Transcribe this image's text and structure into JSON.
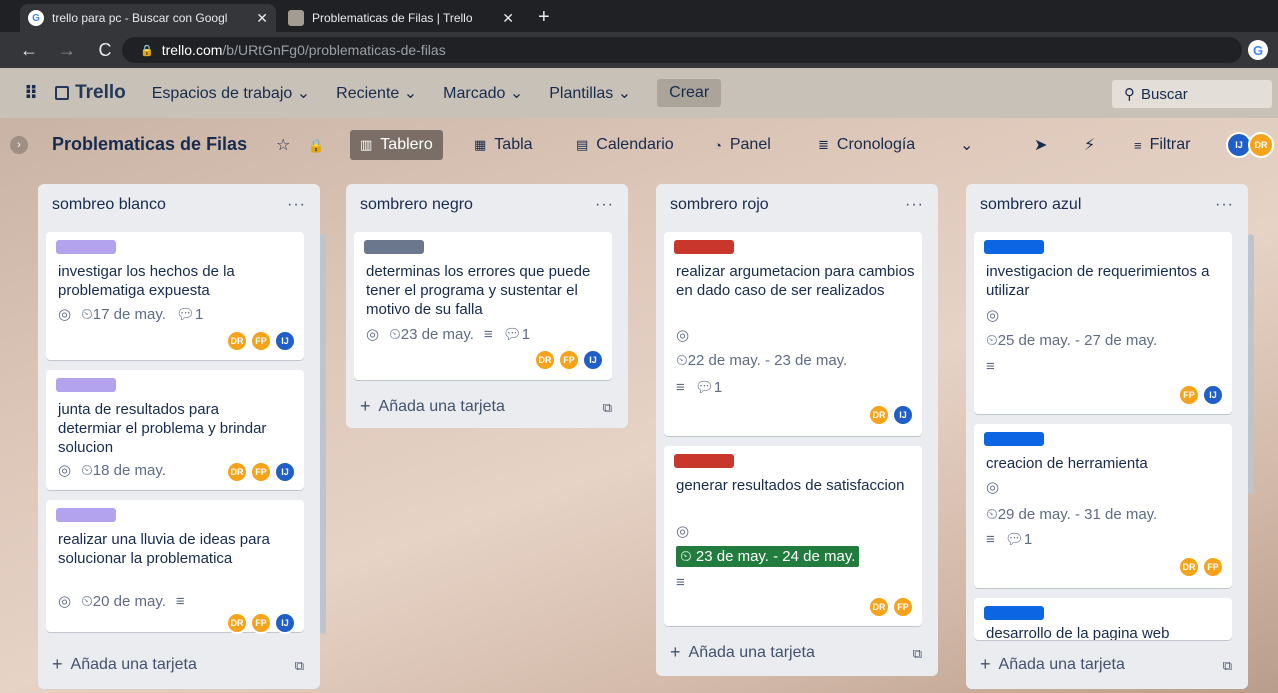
{
  "browser": {
    "tabs": [
      {
        "title": "trello para pc - Buscar con Googl",
        "close": "✕"
      },
      {
        "title": "Problematicas de Filas | Trello",
        "close": "✕"
      }
    ],
    "new_tab": "+",
    "url_domain": "trello.com",
    "url_path": "/b/URtGnFg0/problematicas-de-filas"
  },
  "header": {
    "logo": "Trello",
    "menu": [
      "Espacios de trabajo ⌄",
      "Reciente ⌄",
      "Marcado ⌄",
      "Plantillas ⌄"
    ],
    "create": "Crear",
    "search_placeholder": "Buscar"
  },
  "board": {
    "title": "Problematicas de Filas",
    "views": [
      "Tablero",
      "Tabla",
      "Calendario",
      "Panel",
      "Cronología"
    ],
    "filter": "Filtrar",
    "members": [
      "IJ",
      "DR"
    ]
  },
  "lists": [
    {
      "name": "sombreo blanco",
      "add": "Añada una tarjeta",
      "cards": [
        {
          "text": "investigar los hechos de la problematiga expuesta",
          "date": "17 de may.",
          "comments": "1",
          "members": [
            "DR",
            "FP",
            "IJ"
          ]
        },
        {
          "text": "junta de resultados para determiar el problema y brindar solucion",
          "date": "18 de may.",
          "members": [
            "DR",
            "FP",
            "IJ"
          ]
        },
        {
          "text": "realizar una lluvia de ideas para solucionar la problematica",
          "date": "20 de may.",
          "members": [
            "DR",
            "FP",
            "IJ"
          ]
        }
      ]
    },
    {
      "name": "sombrero negro",
      "add": "Añada una tarjeta",
      "cards": [
        {
          "text": "determinas los errores que puede tener el programa y sustentar el motivo de su falla",
          "date": "23 de may.",
          "comments": "1",
          "members": [
            "DR",
            "FP",
            "IJ"
          ]
        }
      ]
    },
    {
      "name": "sombrero rojo",
      "add": "Añada una tarjeta",
      "cards": [
        {
          "text": "realizar argumetacion para cambios en dado caso de ser realizados",
          "date": "22 de may. - 23 de may.",
          "comments": "1",
          "members": [
            "DR",
            "IJ"
          ]
        },
        {
          "text": "generar resultados de satisfaccion",
          "date": "23 de may. - 24 de may.",
          "members": [
            "DR",
            "FP"
          ]
        }
      ]
    },
    {
      "name": "sombrero azul",
      "add": "Añada una tarjeta",
      "cards": [
        {
          "text": "investigacion de requerimientos a utilizar",
          "date": "25 de may. - 27 de may.",
          "members": [
            "FP",
            "IJ"
          ]
        },
        {
          "text": "creacion de herramienta",
          "date": "29 de may. - 31 de may.",
          "comments": "1",
          "members": [
            "DR",
            "FP"
          ]
        },
        {
          "text": "desarrollo de la pagina web"
        }
      ]
    }
  ],
  "icons": {
    "watch": "◎",
    "clock": "🕓",
    "desc": "≡",
    "comment": "▭",
    "star": "☆",
    "lock": "🔒"
  },
  "colors": {
    "label_purple": "#b3a3ee",
    "label_gray": "#6b778c",
    "label_red": "#c9372c",
    "label_blue": "#0c66e4",
    "due_green": "#217c3e"
  }
}
